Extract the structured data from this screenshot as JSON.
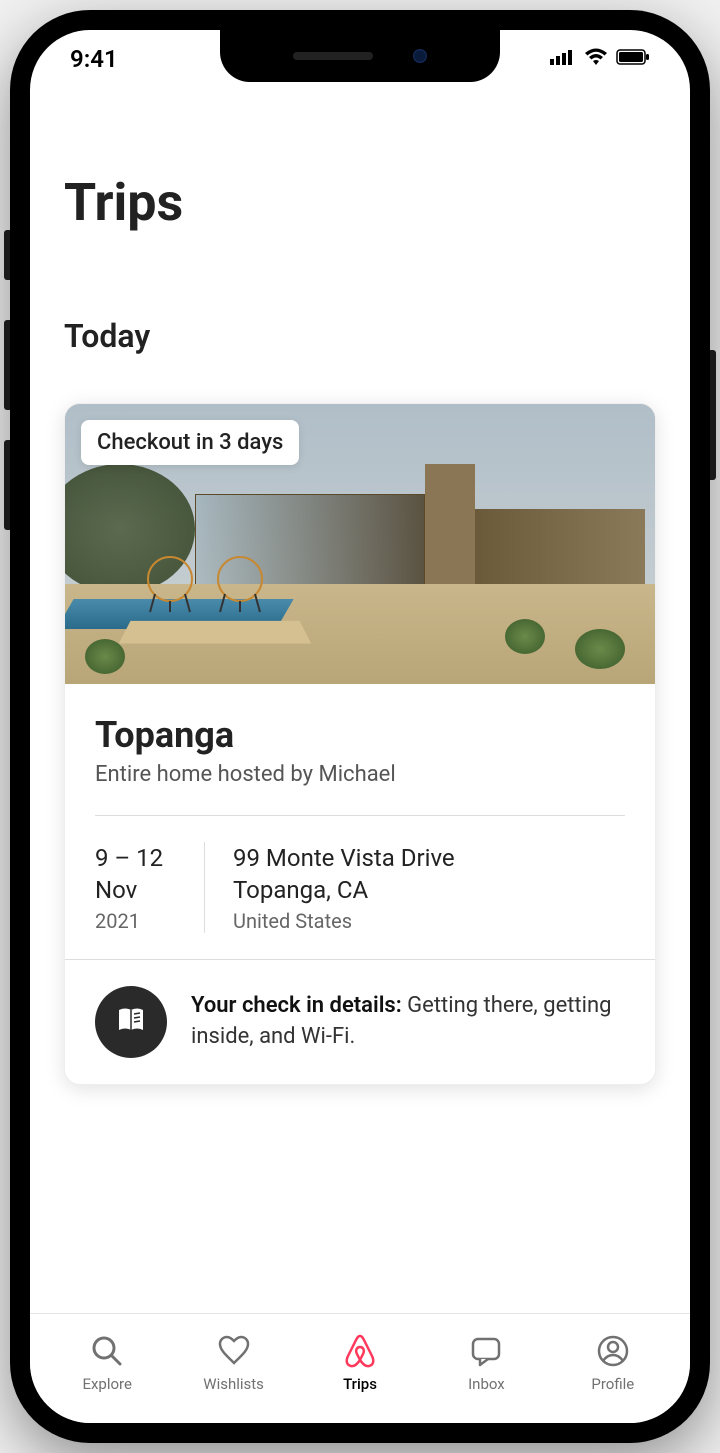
{
  "status_bar": {
    "time": "9:41"
  },
  "page": {
    "title": "Trips"
  },
  "section": {
    "heading": "Today"
  },
  "trip": {
    "badge": "Checkout in 3 days",
    "title": "Topanga",
    "subtitle": "Entire home hosted by Michael",
    "date_range": "9 – 12",
    "date_month": "Nov",
    "date_year": "2021",
    "address_line1": "99 Monte Vista Drive",
    "address_line2": "Topanga, CA",
    "address_country": "United States",
    "checkin_bold": "Your check in details:",
    "checkin_text": " Getting there, getting inside, and Wi-Fi."
  },
  "nav": {
    "items": [
      {
        "label": "Explore",
        "icon": "search-icon"
      },
      {
        "label": "Wishlists",
        "icon": "heart-icon"
      },
      {
        "label": "Trips",
        "icon": "airbnb-icon"
      },
      {
        "label": "Inbox",
        "icon": "inbox-icon"
      },
      {
        "label": "Profile",
        "icon": "profile-icon"
      }
    ],
    "active_index": 2
  },
  "colors": {
    "accent": "#FF385C"
  }
}
